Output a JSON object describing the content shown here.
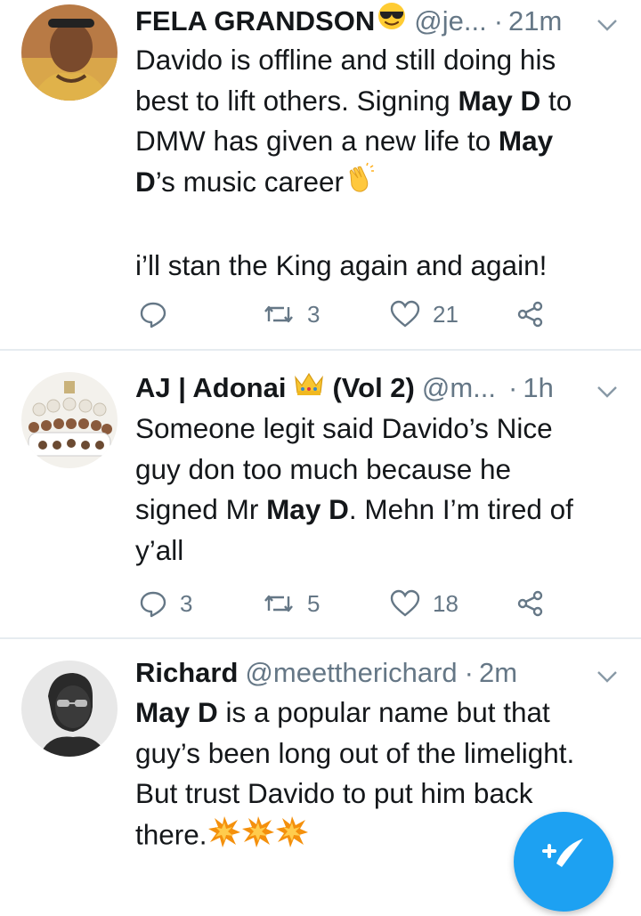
{
  "tweets": [
    {
      "name": "FELA GRANDSON",
      "name_emoji": "sunglasses-emoji",
      "handle": "@je...",
      "sep": "·",
      "time": "21m",
      "body": {
        "l1": "Davido is offline and still doing his",
        "l2a": "best to lift others. Signing ",
        "l2b": "May D",
        "l2c": " to",
        "l3a": "DMW has given a new life to ",
        "l3b": "May",
        "l4a": "D",
        "l4b": "’s music career",
        "l4emoji": "clapping-hands-emoji",
        "l5": "i’ll stan the King again and again!"
      },
      "reply_count": "",
      "retweet_count": "3",
      "like_count": "21"
    },
    {
      "name": "AJ | Adonai",
      "name_emoji": "crown-emoji",
      "name_suffix": "(Vol 2)",
      "handle": "@m...",
      "sep": "·",
      "time": "1h",
      "body": {
        "l1": "Someone legit said Davido’s Nice",
        "l2": "guy don too much because he",
        "l3a": "signed Mr ",
        "l3b": "May D",
        "l3c": ". Mehn I’m tired of",
        "l4": "y’all"
      },
      "reply_count": "3",
      "retweet_count": "5",
      "like_count": "18"
    },
    {
      "name": "Richard",
      "handle": "@meettherichard",
      "sep": "·",
      "time": "2m",
      "body": {
        "l1a": "May D",
        "l1b": " is a popular name but that",
        "l2": "guy’s been long out of the limelight.",
        "l3": "But trust Davido to put him back",
        "l4": "there.",
        "l4emoji": "collision-emoji x3"
      }
    }
  ],
  "colors": {
    "text": "#14171a",
    "secondary": "#657786",
    "divider": "#e6ecf0",
    "fab": "#1da1f2"
  },
  "fab_icon": "compose-tweet-icon"
}
